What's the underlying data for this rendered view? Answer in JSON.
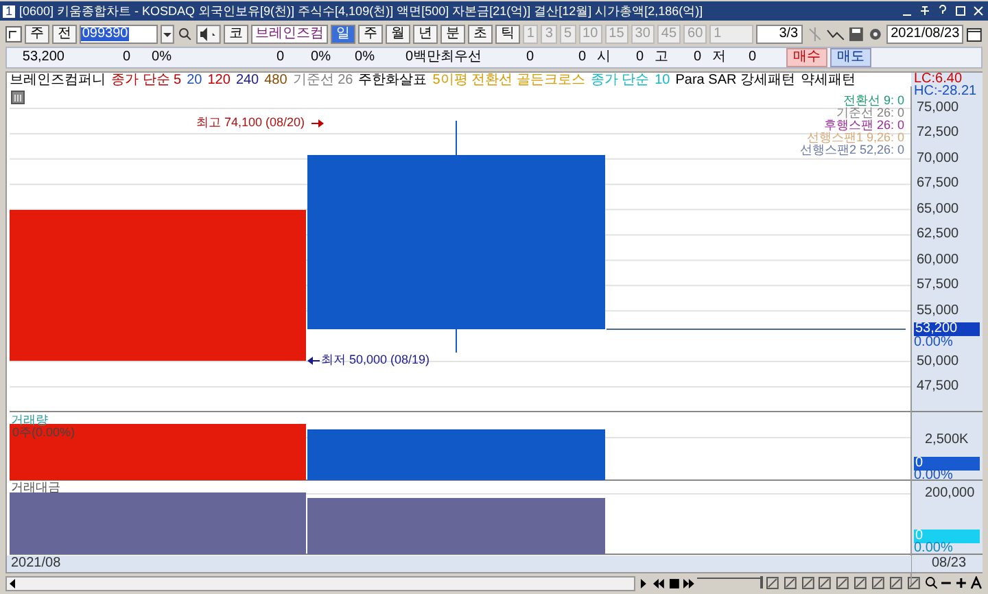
{
  "window": {
    "number": "1",
    "title": "[0600] 키움종합차트 - KOSDAQ 외국인보유[9(천)] 주식수[4,109(천)] 액면[500] 자본금[21(억)] 결산[12월] 시가총액[2,186(억)]"
  },
  "toolbar": {
    "market": "주",
    "scope": "전",
    "code": "099390",
    "market_tag": "코",
    "stock_name": "브레인즈컴",
    "periods": [
      {
        "label": "일",
        "selected": true
      },
      {
        "label": "주",
        "selected": false
      },
      {
        "label": "월",
        "selected": false
      },
      {
        "label": "년",
        "selected": false
      },
      {
        "label": "분",
        "selected": false
      },
      {
        "label": "초",
        "selected": false
      },
      {
        "label": "틱",
        "selected": false
      }
    ],
    "intervals": [
      "1",
      "3",
      "5",
      "10",
      "15",
      "30",
      "45",
      "60"
    ],
    "interval_count": "1",
    "page": "3/3",
    "date": "2021/08/23"
  },
  "quote": {
    "cells": [
      "53,200",
      "0",
      "0%",
      "0",
      "0%",
      "0%",
      "0백만",
      "최우선",
      "0",
      "0",
      "시",
      "0",
      "고",
      "0",
      "저",
      "0"
    ],
    "buy": "매수",
    "sell": "매도"
  },
  "legend": [
    {
      "text": "브레인즈컴퍼니",
      "color": "#000000"
    },
    {
      "text": "종가 단순 5",
      "color": "#c00000"
    },
    {
      "text": "20",
      "color": "#1f4fbf"
    },
    {
      "text": "120",
      "color": "#c00000"
    },
    {
      "text": "240",
      "color": "#1a1a8c"
    },
    {
      "text": "480",
      "color": "#8a4b00"
    },
    {
      "text": "기준선 26",
      "color": "#808080"
    },
    {
      "text": "주한화살표",
      "color": "#000000"
    },
    {
      "text": "5이평 전환선 골든크로스",
      "color": "#d89a00"
    },
    {
      "text": "종가 단순",
      "color": "#10b8c8"
    },
    {
      "text": "10",
      "color": "#10b8c8"
    },
    {
      "text": "Para SAR 강세패턴",
      "color": "#000000"
    },
    {
      "text": "약세패턴",
      "color": "#000000"
    }
  ],
  "lc": "LC:6.40",
  "hc": "HC:-28.21",
  "price_panel": {
    "ichimoku": [
      {
        "text": "전환선 9: 0",
        "color": "#1a9a6a"
      },
      {
        "text": "기준선 26: 0",
        "color": "#808080"
      },
      {
        "text": "후행스팬 26: 0",
        "color": "#9a2a9a"
      },
      {
        "text": "선행스팬1 9,26: 0",
        "color": "#d8a878"
      },
      {
        "text": "선행스팬2 52,26: 0",
        "color": "#6a7aa8"
      }
    ],
    "high_marker": "최고 74,100 (08/20)",
    "low_marker": "최저 50,000 (08/19)",
    "candles": [
      {
        "color": "#e41a0a"
      },
      {
        "color": "#1259c8"
      }
    ],
    "ticks": [
      "75,000",
      "72,500",
      "70,000",
      "67,500",
      "65,000",
      "62,500",
      "60,000",
      "57,500",
      "55,000",
      "50,000",
      "47,500"
    ],
    "current": "53,200",
    "change": "0.00%"
  },
  "volume_panel": {
    "title": "거래량",
    "info": "0주(0.00%)",
    "tick": "2,500K",
    "current": "0",
    "change": "0.00%"
  },
  "amount_panel": {
    "title": "거래대금",
    "tick": "200,000",
    "current": "0",
    "change": "0.00%"
  },
  "dates": {
    "start": "2021/08",
    "end": "08/23"
  },
  "zoom": {
    "level": 1
  }
}
